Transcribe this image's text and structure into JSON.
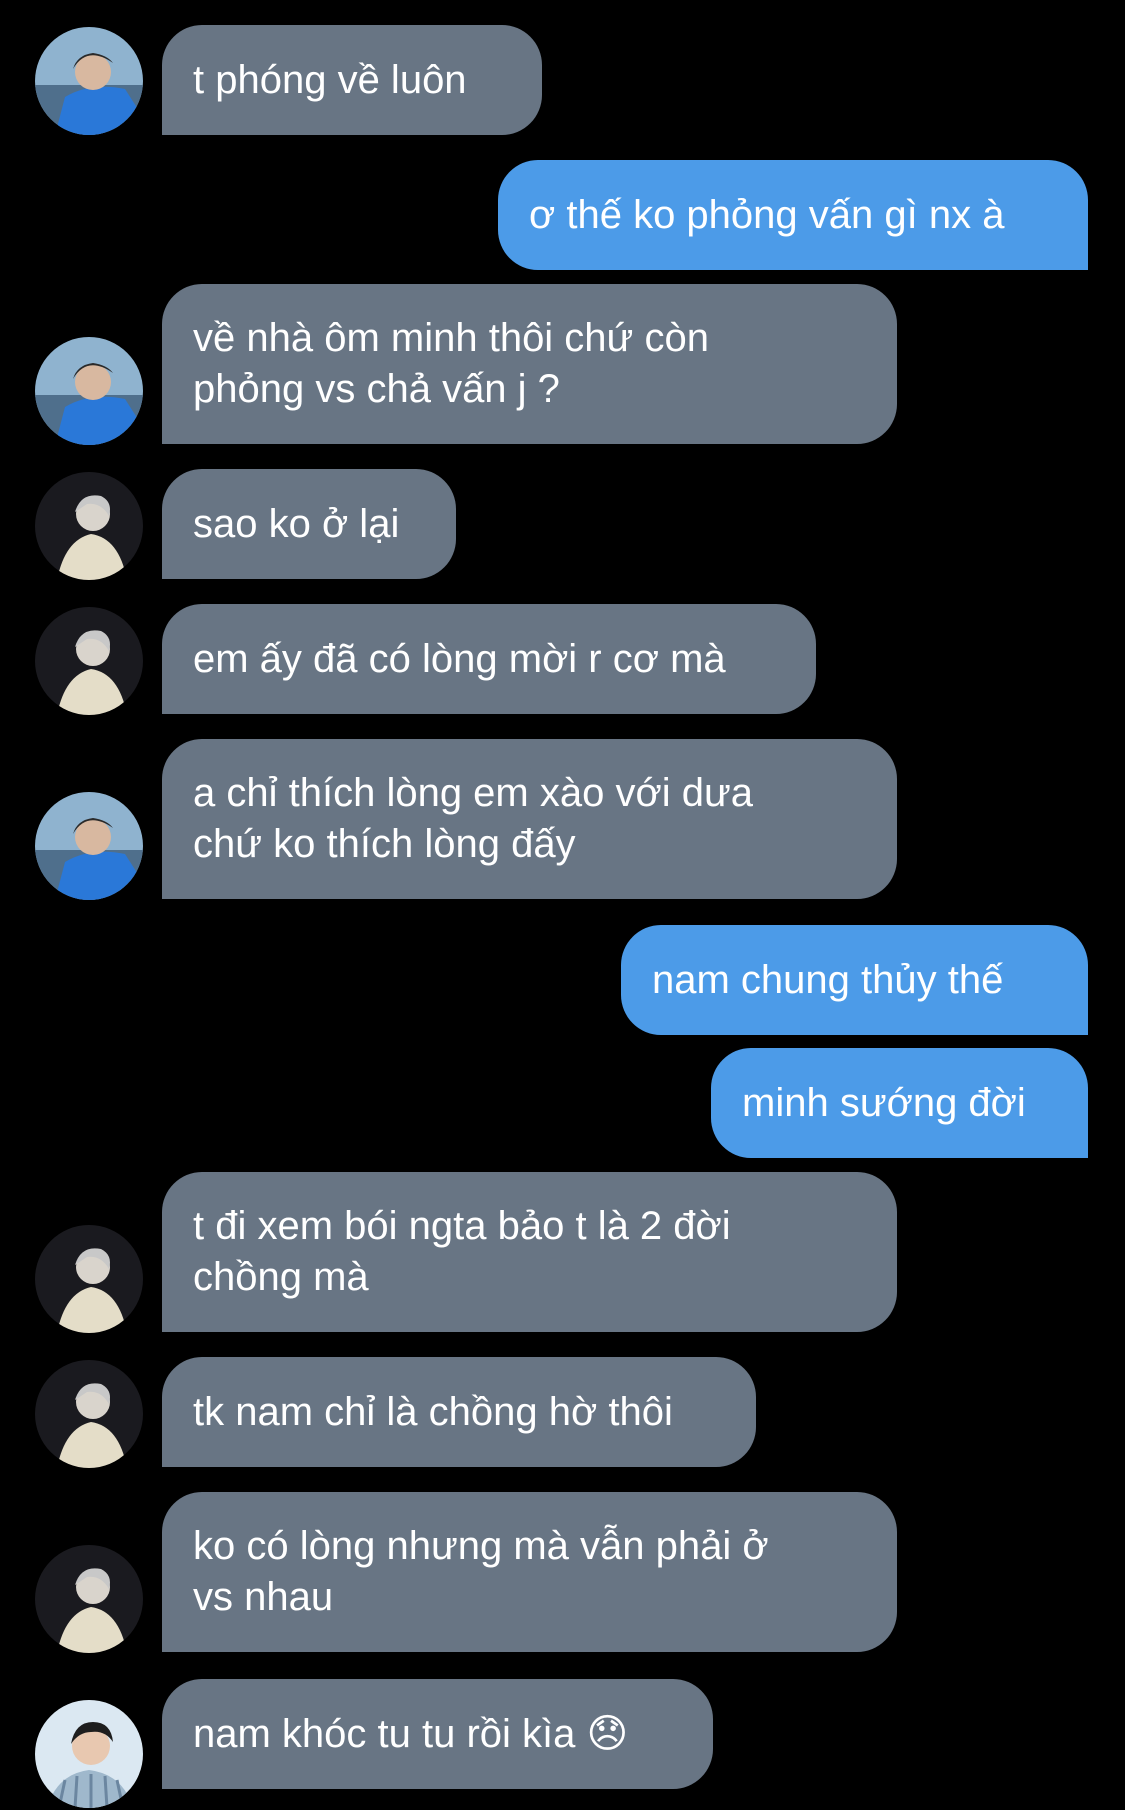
{
  "messages": [
    {
      "side": "in",
      "avatar": "blue-shirt-boy-avatar",
      "text": "t phóng về luôn"
    },
    {
      "side": "out",
      "text": "ơ thế ko phỏng vấn gì nx à"
    },
    {
      "side": "in",
      "avatar": "blue-shirt-boy-avatar",
      "text": "về nhà ôm minh thôi chứ còn\nphỏng vs chả vấn j ?"
    },
    {
      "side": "in",
      "avatar": "white-hair-coat-avatar",
      "text": "sao ko ở lại"
    },
    {
      "side": "in",
      "avatar": "white-hair-coat-avatar",
      "text": "em ấy đã có lòng mời r cơ mà"
    },
    {
      "side": "in",
      "avatar": "blue-shirt-boy-avatar",
      "text": "a chỉ thích lòng em xào với dưa\nchứ ko thích lòng đấy"
    },
    {
      "side": "out",
      "text": "nam chung thủy thế"
    },
    {
      "side": "out",
      "text": "minh sướng đời"
    },
    {
      "side": "in",
      "avatar": "white-hair-coat-avatar",
      "text": "t đi xem bói ngta bảo t là 2 đời\nchồng mà"
    },
    {
      "side": "in",
      "avatar": "white-hair-coat-avatar",
      "text": "tk nam chỉ là chồng hờ thôi"
    },
    {
      "side": "in",
      "avatar": "white-hair-coat-avatar",
      "text": "ko có lòng nhưng mà vẫn phải ở\nvs nhau"
    },
    {
      "side": "in",
      "avatar": "plaid-shirt-man-avatar",
      "text": "nam khóc tu tu rồi kìa 😞"
    }
  ],
  "colors": {
    "background": "#000000",
    "incoming_bubble": "#687584",
    "outgoing_bubble": "#4c9be8",
    "text": "#ffffff"
  }
}
